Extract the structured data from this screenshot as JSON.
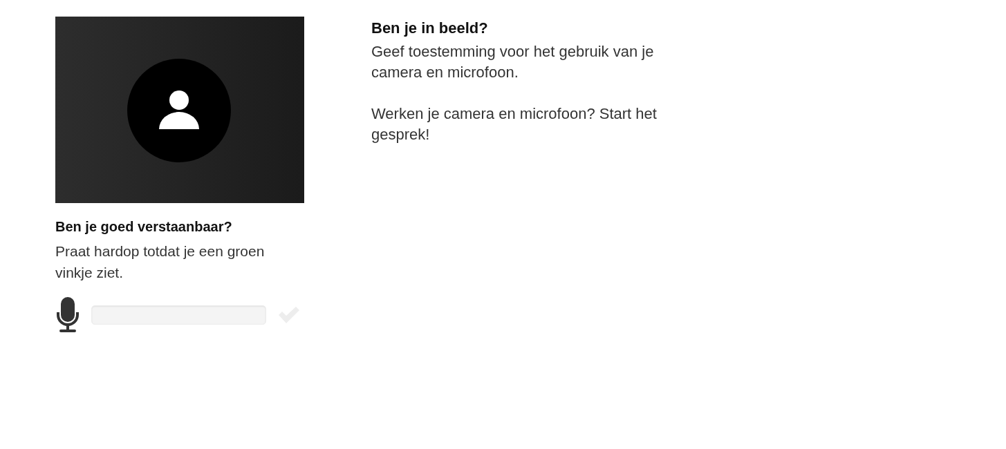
{
  "audio_check": {
    "title": "Ben je goed verstaanbaar?",
    "description": "Praat hardop totdat je een groen vinkje ziet.",
    "level": 0,
    "verified": false
  },
  "video_check": {
    "title": "Ben je in beeld?",
    "paragraphs": [
      "Geef toestemming voor het gebruik van je camera en microfoon.",
      "Werken je camera en microfoon? Start het gesprek!"
    ]
  }
}
